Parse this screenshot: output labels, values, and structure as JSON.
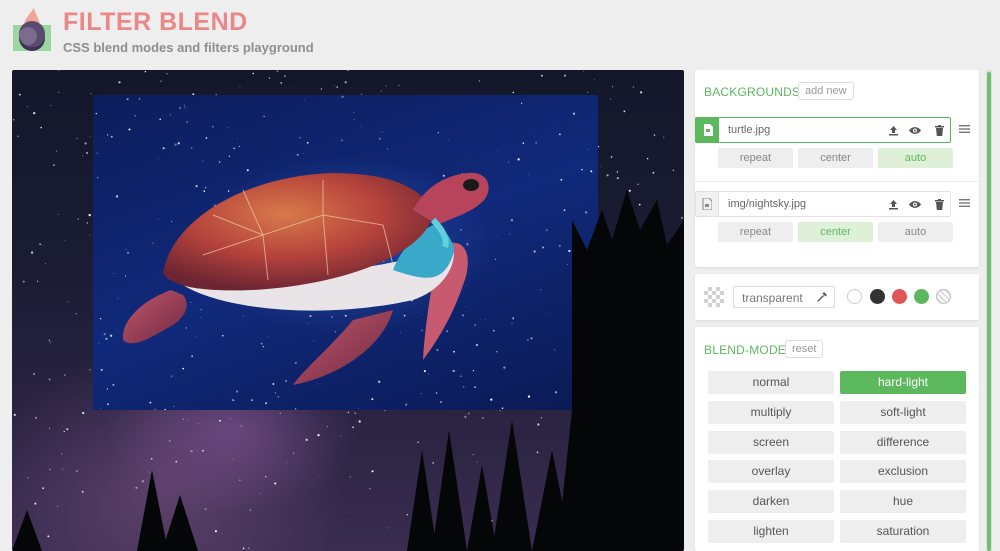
{
  "header": {
    "title": "FILTER BLEND",
    "subtitle": "CSS blend modes and filters playground",
    "colors": {
      "title": "#ec8787",
      "accent": "#5cb85c"
    }
  },
  "backgrounds": {
    "title": "BACKGROUNDS",
    "add_label": "add new",
    "layers": [
      {
        "name": "turtle.jpg",
        "active": true,
        "thumb_icon": "image-file-icon",
        "actions": [
          "upload-icon",
          "eye-icon",
          "trash-icon"
        ],
        "options": [
          "repeat",
          "center",
          "auto"
        ],
        "selected_option": "auto"
      },
      {
        "name": "img/nightsky.jpg",
        "active": false,
        "thumb_icon": "image-file-icon",
        "actions": [
          "upload-icon",
          "eye-icon",
          "trash-icon"
        ],
        "options": [
          "repeat",
          "center",
          "auto"
        ],
        "selected_option": "center"
      }
    ]
  },
  "background_color": {
    "value": "transparent",
    "swatches": [
      "#ffffff",
      "#333333",
      "#e05555",
      "#5cb85c",
      "transparent"
    ]
  },
  "blend_mode": {
    "title": "BLEND-MODE",
    "reset_label": "reset",
    "options": [
      "normal",
      "hard-light",
      "multiply",
      "soft-light",
      "screen",
      "difference",
      "overlay",
      "exclusion",
      "darken",
      "hue",
      "lighten",
      "saturation"
    ],
    "selected": "hard-light"
  }
}
